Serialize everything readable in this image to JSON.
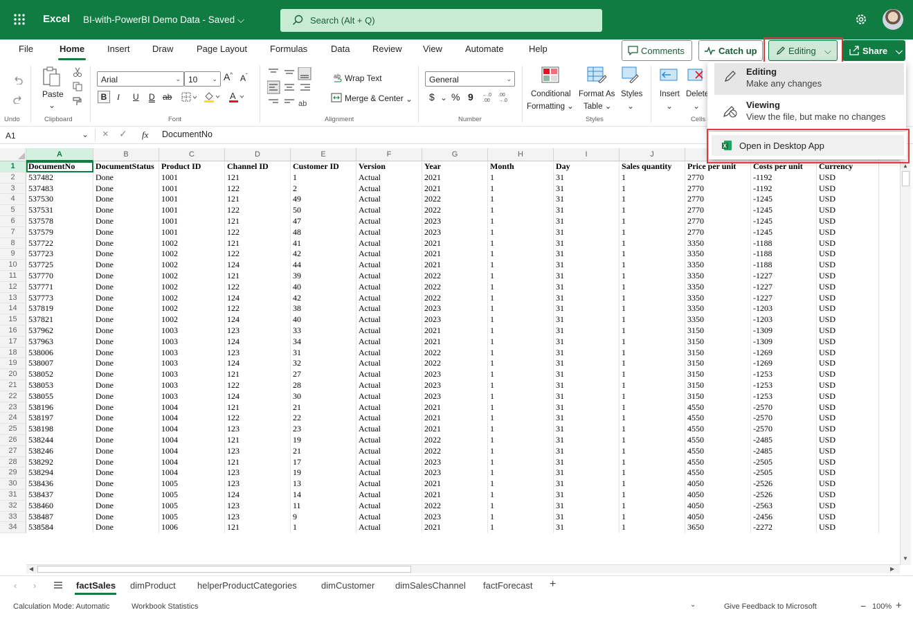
{
  "titlebar": {
    "app_name": "Excel",
    "doc_name": "BI-with-PowerBI Demo Data - Saved",
    "search_placeholder": "Search (Alt + Q)"
  },
  "menu": {
    "tabs": [
      "File",
      "Home",
      "Insert",
      "Draw",
      "Page Layout",
      "Formulas",
      "Data",
      "Review",
      "View",
      "Automate",
      "Help"
    ],
    "comments": "Comments",
    "catchup": "Catch up",
    "editing": "Editing",
    "share": "Share"
  },
  "ribbon": {
    "undo_label": "Undo",
    "clipboard": {
      "paste": "Paste",
      "group": "Clipboard"
    },
    "font": {
      "name": "Arial",
      "size": "10",
      "group": "Font",
      "bold": "B",
      "italic": "I",
      "underline": "U",
      "double_underline": "D",
      "strike": "ab"
    },
    "alignment": {
      "wrap": "Wrap Text",
      "merge": "Merge & Center",
      "group": "Alignment"
    },
    "number": {
      "format": "General",
      "currency": "$",
      "percent": "%",
      "comma": "9",
      "group": "Number"
    },
    "styles": {
      "conditional": "Conditional",
      "formatting": "Formatting",
      "format_as": "Format As",
      "table": "Table",
      "styles": "Styles",
      "group": "Styles"
    },
    "cells": {
      "insert": "Insert",
      "delete": "Delete",
      "group": "Cells"
    }
  },
  "formula_bar": {
    "cell_ref": "A1",
    "fx": "fx",
    "value": "DocumentNo"
  },
  "columns": [
    "A",
    "B",
    "C",
    "D",
    "E",
    "F",
    "G",
    "H",
    "I",
    "J"
  ],
  "header_row": [
    "DocumentNo",
    "DocumentStatus",
    "Product ID",
    "Channel ID",
    "Customer ID",
    "Version",
    "Year",
    "Month",
    "Day",
    "Sales quantity",
    "Price per unit",
    "Costs per unit",
    "Currency"
  ],
  "rows": [
    [
      "537482",
      "Done",
      "1001",
      "121",
      "1",
      "Actual",
      "2021",
      "1",
      "31",
      "1",
      "2770",
      "-1192",
      "USD"
    ],
    [
      "537483",
      "Done",
      "1001",
      "122",
      "2",
      "Actual",
      "2021",
      "1",
      "31",
      "1",
      "2770",
      "-1192",
      "USD"
    ],
    [
      "537530",
      "Done",
      "1001",
      "121",
      "49",
      "Actual",
      "2022",
      "1",
      "31",
      "1",
      "2770",
      "-1245",
      "USD"
    ],
    [
      "537531",
      "Done",
      "1001",
      "122",
      "50",
      "Actual",
      "2022",
      "1",
      "31",
      "1",
      "2770",
      "-1245",
      "USD"
    ],
    [
      "537578",
      "Done",
      "1001",
      "121",
      "47",
      "Actual",
      "2023",
      "1",
      "31",
      "1",
      "2770",
      "-1245",
      "USD"
    ],
    [
      "537579",
      "Done",
      "1001",
      "122",
      "48",
      "Actual",
      "2023",
      "1",
      "31",
      "1",
      "2770",
      "-1245",
      "USD"
    ],
    [
      "537722",
      "Done",
      "1002",
      "121",
      "41",
      "Actual",
      "2021",
      "1",
      "31",
      "1",
      "3350",
      "-1188",
      "USD"
    ],
    [
      "537723",
      "Done",
      "1002",
      "122",
      "42",
      "Actual",
      "2021",
      "1",
      "31",
      "1",
      "3350",
      "-1188",
      "USD"
    ],
    [
      "537725",
      "Done",
      "1002",
      "124",
      "44",
      "Actual",
      "2021",
      "1",
      "31",
      "1",
      "3350",
      "-1188",
      "USD"
    ],
    [
      "537770",
      "Done",
      "1002",
      "121",
      "39",
      "Actual",
      "2022",
      "1",
      "31",
      "1",
      "3350",
      "-1227",
      "USD"
    ],
    [
      "537771",
      "Done",
      "1002",
      "122",
      "40",
      "Actual",
      "2022",
      "1",
      "31",
      "1",
      "3350",
      "-1227",
      "USD"
    ],
    [
      "537773",
      "Done",
      "1002",
      "124",
      "42",
      "Actual",
      "2022",
      "1",
      "31",
      "1",
      "3350",
      "-1227",
      "USD"
    ],
    [
      "537819",
      "Done",
      "1002",
      "122",
      "38",
      "Actual",
      "2023",
      "1",
      "31",
      "1",
      "3350",
      "-1203",
      "USD"
    ],
    [
      "537821",
      "Done",
      "1002",
      "124",
      "40",
      "Actual",
      "2023",
      "1",
      "31",
      "1",
      "3350",
      "-1203",
      "USD"
    ],
    [
      "537962",
      "Done",
      "1003",
      "123",
      "33",
      "Actual",
      "2021",
      "1",
      "31",
      "1",
      "3150",
      "-1309",
      "USD"
    ],
    [
      "537963",
      "Done",
      "1003",
      "124",
      "34",
      "Actual",
      "2021",
      "1",
      "31",
      "1",
      "3150",
      "-1309",
      "USD"
    ],
    [
      "538006",
      "Done",
      "1003",
      "123",
      "31",
      "Actual",
      "2022",
      "1",
      "31",
      "1",
      "3150",
      "-1269",
      "USD"
    ],
    [
      "538007",
      "Done",
      "1003",
      "124",
      "32",
      "Actual",
      "2022",
      "1",
      "31",
      "1",
      "3150",
      "-1269",
      "USD"
    ],
    [
      "538052",
      "Done",
      "1003",
      "121",
      "27",
      "Actual",
      "2023",
      "1",
      "31",
      "1",
      "3150",
      "-1253",
      "USD"
    ],
    [
      "538053",
      "Done",
      "1003",
      "122",
      "28",
      "Actual",
      "2023",
      "1",
      "31",
      "1",
      "3150",
      "-1253",
      "USD"
    ],
    [
      "538055",
      "Done",
      "1003",
      "124",
      "30",
      "Actual",
      "2023",
      "1",
      "31",
      "1",
      "3150",
      "-1253",
      "USD"
    ],
    [
      "538196",
      "Done",
      "1004",
      "121",
      "21",
      "Actual",
      "2021",
      "1",
      "31",
      "1",
      "4550",
      "-2570",
      "USD"
    ],
    [
      "538197",
      "Done",
      "1004",
      "122",
      "22",
      "Actual",
      "2021",
      "1",
      "31",
      "1",
      "4550",
      "-2570",
      "USD"
    ],
    [
      "538198",
      "Done",
      "1004",
      "123",
      "23",
      "Actual",
      "2021",
      "1",
      "31",
      "1",
      "4550",
      "-2570",
      "USD"
    ],
    [
      "538244",
      "Done",
      "1004",
      "121",
      "19",
      "Actual",
      "2022",
      "1",
      "31",
      "1",
      "4550",
      "-2485",
      "USD"
    ],
    [
      "538246",
      "Done",
      "1004",
      "123",
      "21",
      "Actual",
      "2022",
      "1",
      "31",
      "1",
      "4550",
      "-2485",
      "USD"
    ],
    [
      "538292",
      "Done",
      "1004",
      "121",
      "17",
      "Actual",
      "2023",
      "1",
      "31",
      "1",
      "4550",
      "-2505",
      "USD"
    ],
    [
      "538294",
      "Done",
      "1004",
      "123",
      "19",
      "Actual",
      "2023",
      "1",
      "31",
      "1",
      "4550",
      "-2505",
      "USD"
    ],
    [
      "538436",
      "Done",
      "1005",
      "123",
      "13",
      "Actual",
      "2021",
      "1",
      "31",
      "1",
      "4050",
      "-2526",
      "USD"
    ],
    [
      "538437",
      "Done",
      "1005",
      "124",
      "14",
      "Actual",
      "2021",
      "1",
      "31",
      "1",
      "4050",
      "-2526",
      "USD"
    ],
    [
      "538460",
      "Done",
      "1005",
      "123",
      "11",
      "Actual",
      "2022",
      "1",
      "31",
      "1",
      "4050",
      "-2563",
      "USD"
    ],
    [
      "538487",
      "Done",
      "1005",
      "123",
      "9",
      "Actual",
      "2023",
      "1",
      "31",
      "1",
      "4050",
      "-2456",
      "USD"
    ],
    [
      "538584",
      "Done",
      "1006",
      "121",
      "1",
      "Actual",
      "2021",
      "1",
      "31",
      "1",
      "3650",
      "-2272",
      "USD"
    ]
  ],
  "sheets": [
    "factSales",
    "dimProduct",
    "helperProductCategories",
    "dimCustomer",
    "dimSalesChannel",
    "factForecast"
  ],
  "status": {
    "calc_mode": "Calculation Mode: Automatic",
    "workbook_stats": "Workbook Statistics",
    "feedback": "Give Feedback to Microsoft",
    "zoom": "100%"
  },
  "editing_menu": {
    "editing_title": "Editing",
    "editing_desc": "Make any changes",
    "viewing_title": "Viewing",
    "viewing_desc": "View the file, but make no changes",
    "open_desktop": "Open in Desktop App"
  },
  "colors": {
    "brand": "#107c41",
    "highlight": "#e03a3a"
  }
}
